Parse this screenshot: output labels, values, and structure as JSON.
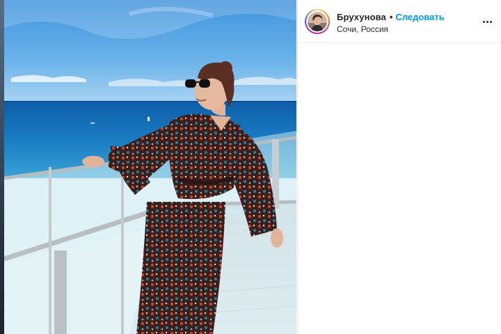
{
  "post": {
    "username": "Брухунова",
    "separator": "•",
    "follow_label": "Следовать",
    "location": "Сочи, Россия"
  },
  "icons": {
    "more": "more-options-icon",
    "avatar": "profile-avatar"
  },
  "colors": {
    "follow_blue": "#0095f6",
    "text": "#262626",
    "sea": "#1f7fc0",
    "sky": "#5aa7e3",
    "dress": "#3a1f1c"
  },
  "photo": {
    "description_icon": "post-photo"
  }
}
